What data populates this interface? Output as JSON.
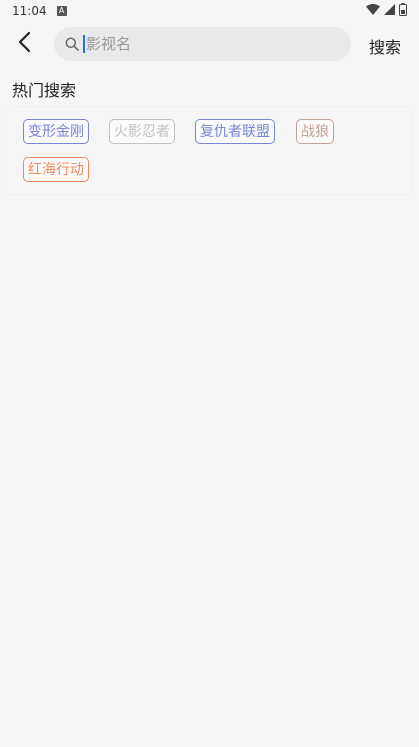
{
  "status_bar": {
    "time": "11:04",
    "notif_icon": "A",
    "icons": [
      "wifi-icon",
      "signal-icon",
      "battery-icon"
    ]
  },
  "header": {
    "back_icon": "chevron-left-icon",
    "search_placeholder": "影视名",
    "search_button": "搜索"
  },
  "hot_search": {
    "title": "热门搜索",
    "tags": [
      {
        "label": "变形金刚",
        "color": "#7a85d4"
      },
      {
        "label": "火影忍者",
        "color": "#c2c2c2"
      },
      {
        "label": "复仇者联盟",
        "color": "#7a85d4"
      },
      {
        "label": "战狼",
        "color": "#c4a29a"
      },
      {
        "label": "红海行动",
        "color": "#f08a5d"
      }
    ]
  }
}
